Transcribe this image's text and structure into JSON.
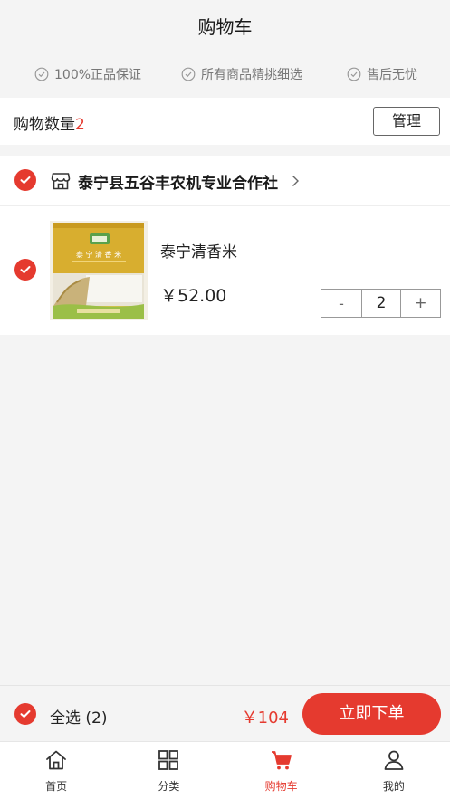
{
  "header": {
    "title": "购物车",
    "guarantees": [
      "100%正品保证",
      "所有商品精挑细选",
      "售后无忧"
    ]
  },
  "cart": {
    "count_label": "购物数量",
    "count": "2",
    "manage_label": "管理"
  },
  "store": {
    "name": "泰宁县五谷丰农机专业合作社",
    "checked": true
  },
  "product": {
    "name": "泰宁清香米",
    "price": "￥52.00",
    "quantity": "2",
    "minus": "-",
    "plus": "+",
    "package_text": "泰 宁 清 香 米",
    "checked": true
  },
  "checkout": {
    "select_all": "全选 (2)",
    "total": "￥104",
    "order_button": "立即下单"
  },
  "tabbar": {
    "items": [
      {
        "label": "首页",
        "icon": "home-icon"
      },
      {
        "label": "分类",
        "icon": "grid-icon"
      },
      {
        "label": "购物车",
        "icon": "cart-icon"
      },
      {
        "label": "我的",
        "icon": "user-icon"
      }
    ],
    "active_index": 2
  },
  "colors": {
    "accent": "#e53a2f",
    "background": "#f4f4f4"
  }
}
